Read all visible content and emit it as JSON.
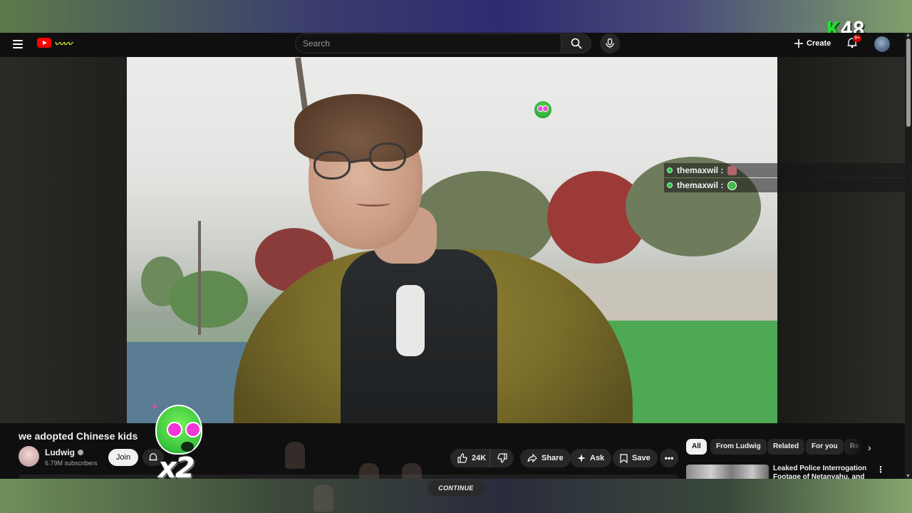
{
  "overlay": {
    "brand_k": "K",
    "brand_number": "48",
    "multiplier": "x2",
    "continue_label": "CONTINUE"
  },
  "masthead": {
    "search_placeholder": "Search",
    "create_label": "Create",
    "notification_count": "9+"
  },
  "chat": [
    {
      "user": "themaxwil :",
      "emote_color": "#b5656d"
    },
    {
      "user": "themaxwil :",
      "emote_color": "#3fbf4a"
    }
  ],
  "video": {
    "title": "we adopted Chinese kids",
    "channel": "Ludwig",
    "subscribers": "6.79M subscribers",
    "join_label": "Join",
    "likes": "24K",
    "share_label": "Share",
    "ask_label": "Ask",
    "save_label": "Save"
  },
  "chips": [
    "All",
    "From Ludwig",
    "Related",
    "For you",
    "Re"
  ],
  "recommendation": {
    "title": "Leaked Police Interrogation Footage of Netanyahu, and Ho..."
  },
  "colors": {
    "brand_green": "#22e035",
    "youtube_red": "#ff0000",
    "background": "#0f0f0f"
  }
}
